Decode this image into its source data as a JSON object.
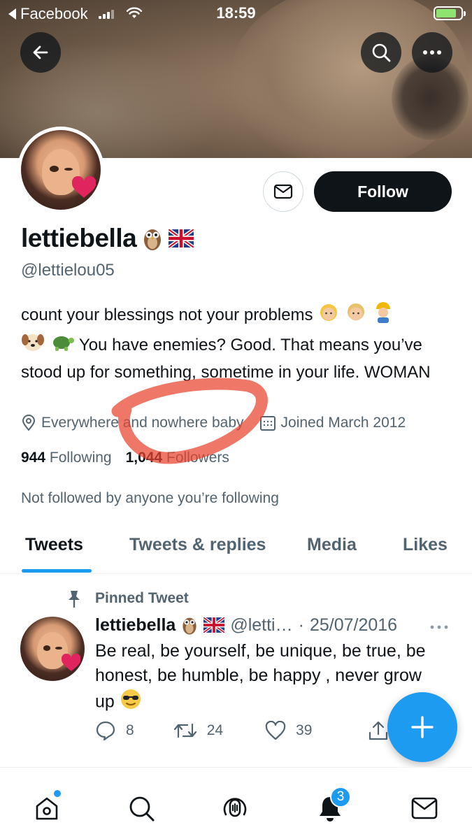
{
  "status_bar": {
    "back_app": "Facebook",
    "time": "18:59"
  },
  "profile": {
    "display_name": "lettiebella",
    "name_emojis": [
      "owl-emoji",
      "uk-flag-emoji"
    ],
    "handle": "@lettielou05",
    "follow_label": "Follow",
    "bio_line1": "count your blessings not your problems",
    "bio_line2": "You have enemies? Good. That means you’ve stood up for something, sometime in your life. WOMAN",
    "location": "Everywhere and nowhere baby",
    "joined": "Joined March 2012",
    "following_count": "944",
    "following_label": "Following",
    "followers_count": "1,044",
    "followers_label": "Followers",
    "mutual_text": "Not followed by anyone you’re following"
  },
  "tabs": [
    {
      "label": "Tweets",
      "active": true
    },
    {
      "label": "Tweets & replies",
      "active": false
    },
    {
      "label": "Media",
      "active": false
    },
    {
      "label": "Likes",
      "active": false
    }
  ],
  "pinned_tweet": {
    "pinned_label": "Pinned Tweet",
    "author_name": "lettiebella",
    "author_handle": "@letti…",
    "separator": "·",
    "date": "25/07/2016",
    "text": "Be real, be yourself, be unique, be true, be honest, be humble, be happy , never grow up",
    "replies": "8",
    "retweets": "24",
    "likes": "39"
  },
  "bottom_nav": {
    "notifications_badge": "3"
  },
  "colors": {
    "accent": "#1d9bf0",
    "text_primary": "#0f1419",
    "text_secondary": "#536471",
    "follow_button": "#0f1419",
    "scribble": "#e8432e"
  }
}
